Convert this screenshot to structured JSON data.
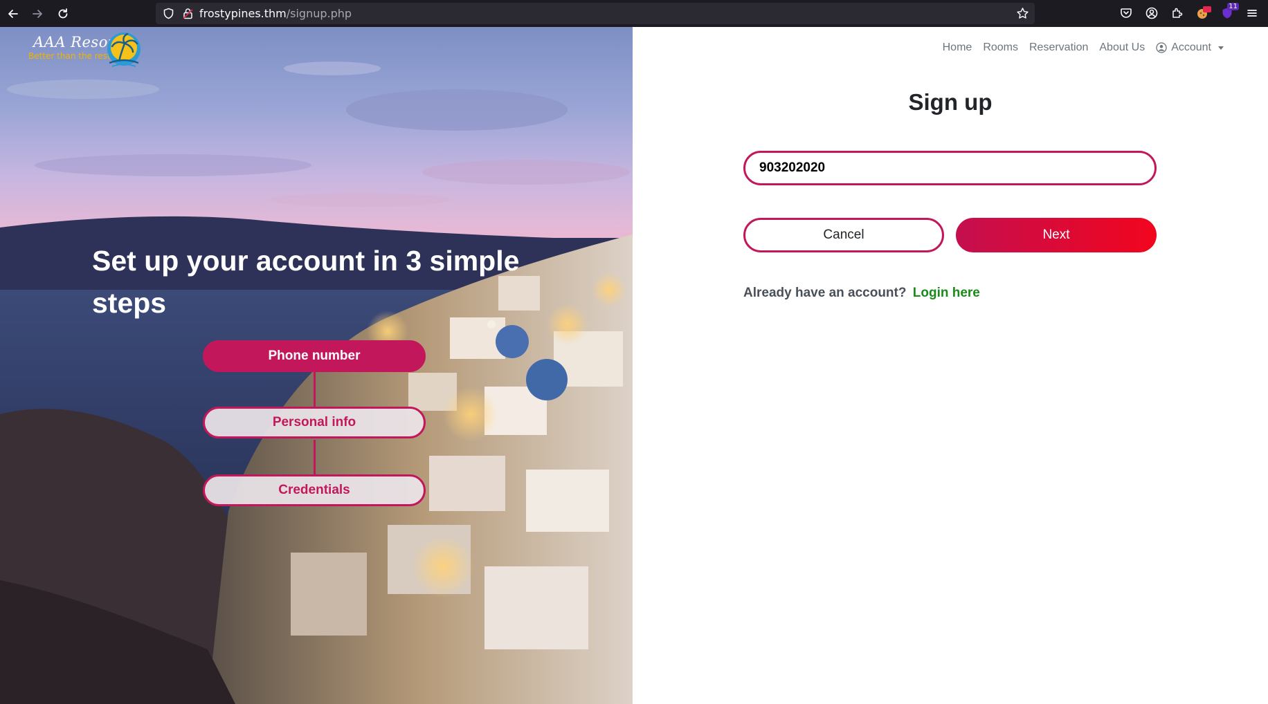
{
  "browser": {
    "url_host": "frostypines.thm",
    "url_path": "/signup.php",
    "extension_badge_count": "11"
  },
  "logo": {
    "name": "AAA Resorts",
    "tagline": "Better than the rest"
  },
  "hero": {
    "title": "Set up your account in 3 simple steps",
    "steps": [
      {
        "label": "Phone number",
        "state": "active"
      },
      {
        "label": "Personal info",
        "state": "inactive"
      },
      {
        "label": "Credentials",
        "state": "inactive"
      }
    ]
  },
  "nav": {
    "items": [
      "Home",
      "Rooms",
      "Reservation",
      "About Us"
    ],
    "account_label": "Account"
  },
  "form": {
    "title": "Sign up",
    "phone_value": "903202020",
    "cancel_label": "Cancel",
    "next_label": "Next",
    "login_prompt": "Already have an account?",
    "login_link": "Login here"
  },
  "colors": {
    "accent": "#c2185b",
    "next_gradient_start": "#c40f4f",
    "next_gradient_end": "#f2051e",
    "login_link": "#1b8a1b",
    "chrome_bg": "#1c1b22"
  }
}
